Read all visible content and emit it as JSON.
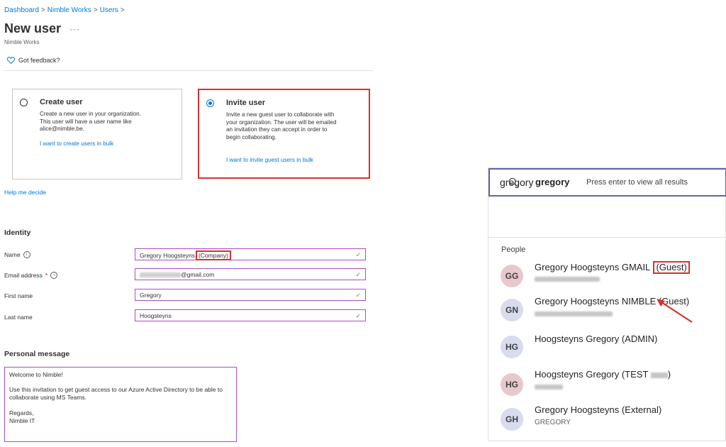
{
  "breadcrumb": {
    "items": [
      "Dashboard",
      "Nimble Works",
      "Users"
    ],
    "sep": ">"
  },
  "header": {
    "title": "New user",
    "more": "···",
    "subtitle": "Nimble Works"
  },
  "feedback": {
    "label": "Got feedback?"
  },
  "options": {
    "create": {
      "title": "Create user",
      "desc": "Create a new user in your organization. This user will have a user name like alice@nimble.be.",
      "link": "I want to create users in bulk",
      "selected": false
    },
    "invite": {
      "title": "Invite user",
      "desc": "Invite a new guest user to collaborate with your organization. The user will be emailed an invitation they can accept in order to begin collaborating.",
      "link": "I want to invite guest users in bulk",
      "selected": true
    }
  },
  "help_link": "Help me decide",
  "identity": {
    "title": "Identity",
    "name": {
      "label": "Name",
      "value": "Gregory Hoogsteyns",
      "suffix": "(Company)"
    },
    "email": {
      "label": "Email address",
      "required": "*",
      "value_suffix": "@gmail.com"
    },
    "first_name": {
      "label": "First name",
      "value": "Gregory"
    },
    "last_name": {
      "label": "Last name",
      "value": "Hoogsteyns"
    }
  },
  "personal_message": {
    "title": "Personal message",
    "lines": [
      "Welcome to Nimble!",
      "Use this invitation to get guest access to our Azure Active Directory to be able to collaborate using MS Teams.",
      "Regards,",
      "Nimble IT"
    ]
  },
  "search": {
    "input_value": "gregory",
    "query": "gregory",
    "hint": "Press enter to view all results",
    "people_label": "People",
    "people": [
      {
        "initials": "GG",
        "name": "Gregory Hoogsteyns GMAIL",
        "tag": "(Guest)",
        "sub": ""
      },
      {
        "initials": "GN",
        "name": "Gregory Hoogsteyns NIMBLE (Guest)",
        "sub": ""
      },
      {
        "initials": "HG",
        "name": "Hoogsteyns Gregory (ADMIN)",
        "sub": ""
      },
      {
        "initials": "HG",
        "name": "Hoogsteyns Gregory (TEST",
        "tag_end": ")",
        "sub": ""
      },
      {
        "initials": "GH",
        "name": "Gregory Hoogsteyns (External)",
        "sub": "GREGORY"
      }
    ]
  },
  "colors": {
    "accent": "#0078d4",
    "highlight": "#d9302c",
    "field_border": "#a94ec0",
    "valid": "#57a300",
    "teams_accent": "#6264a7"
  }
}
